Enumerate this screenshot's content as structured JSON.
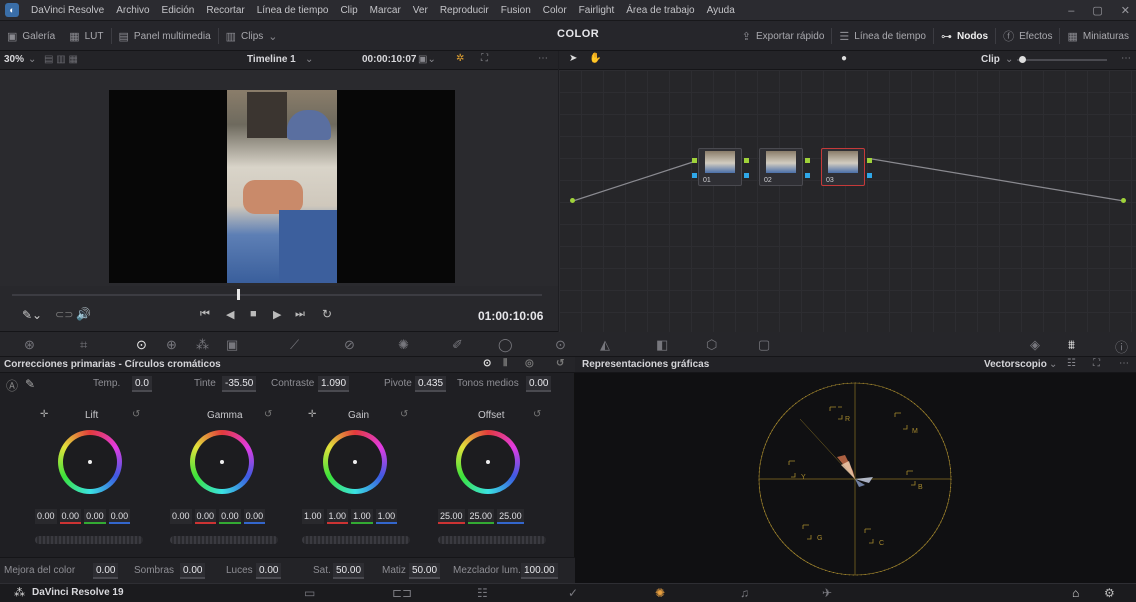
{
  "menubar": {
    "app": "DaVinci Resolve",
    "items": [
      "Archivo",
      "Edición",
      "Recortar",
      "Línea de tiempo",
      "Clip",
      "Marcar",
      "Ver",
      "Reproducir",
      "Fusion",
      "Color",
      "Fairlight",
      "Área de trabajo",
      "Ayuda"
    ],
    "win": [
      "–",
      "▢",
      "✕"
    ]
  },
  "toolbar": {
    "galeria": "Galería",
    "lut": "LUT",
    "multimedia": "Panel multimedia",
    "clips": "Clips",
    "page": "COLOR",
    "exportar": "Exportar rápido",
    "timeline": "Línea de tiempo",
    "nodos": "Nodos",
    "efectos": "Efectos",
    "miniaturas": "Miniaturas"
  },
  "viewer": {
    "zoom": "30%",
    "timeline_name": "Timeline 1",
    "timecode": "00:00:10:07",
    "transport_timecode": "01:00:10:06"
  },
  "nodes": {
    "clip_label": "Clip",
    "items": [
      {
        "label": "01"
      },
      {
        "label": "02"
      },
      {
        "label": "03"
      }
    ]
  },
  "primaries": {
    "title": "Correcciones primarias - Círculos cromáticos",
    "temp_label": "Temp.",
    "temp": "0.0",
    "tinte_label": "Tinte",
    "tinte": "-35.50",
    "contraste_label": "Contraste",
    "contraste": "1.090",
    "pivote_label": "Pivote",
    "pivote": "0.435",
    "tonos_label": "Tonos medios",
    "tonos": "0.00",
    "wheels": [
      {
        "name": "Lift",
        "v": [
          "0.00",
          "0.00",
          "0.00",
          "0.00"
        ]
      },
      {
        "name": "Gamma",
        "v": [
          "0.00",
          "0.00",
          "0.00",
          "0.00"
        ]
      },
      {
        "name": "Gain",
        "v": [
          "1.00",
          "1.00",
          "1.00",
          "1.00"
        ]
      },
      {
        "name": "Offset",
        "v": [
          "25.00",
          "25.00",
          "25.00"
        ]
      }
    ],
    "mejora_label": "Mejora del color",
    "mejora": "0.00",
    "sombras_label": "Sombras",
    "sombras": "0.00",
    "luces_label": "Luces",
    "luces": "0.00",
    "sat_label": "Sat.",
    "sat": "50.00",
    "matiz_label": "Matiz",
    "matiz": "50.00",
    "mezclador_label": "Mezclador lum.",
    "mezclador": "100.00"
  },
  "scopes": {
    "title": "Representaciones gráficas",
    "mode": "Vectorscopio",
    "targets": [
      "R",
      "M",
      "B",
      "C",
      "G",
      "Y"
    ]
  },
  "footer": {
    "app": "DaVinci Resolve 19"
  },
  "colors": {
    "accent": "#e05a28",
    "selected_node": "#c63a3a",
    "pin_green": "#9fd23a",
    "pin_blue": "#2fa7e8",
    "scope_graticule": "#a78a2e"
  }
}
